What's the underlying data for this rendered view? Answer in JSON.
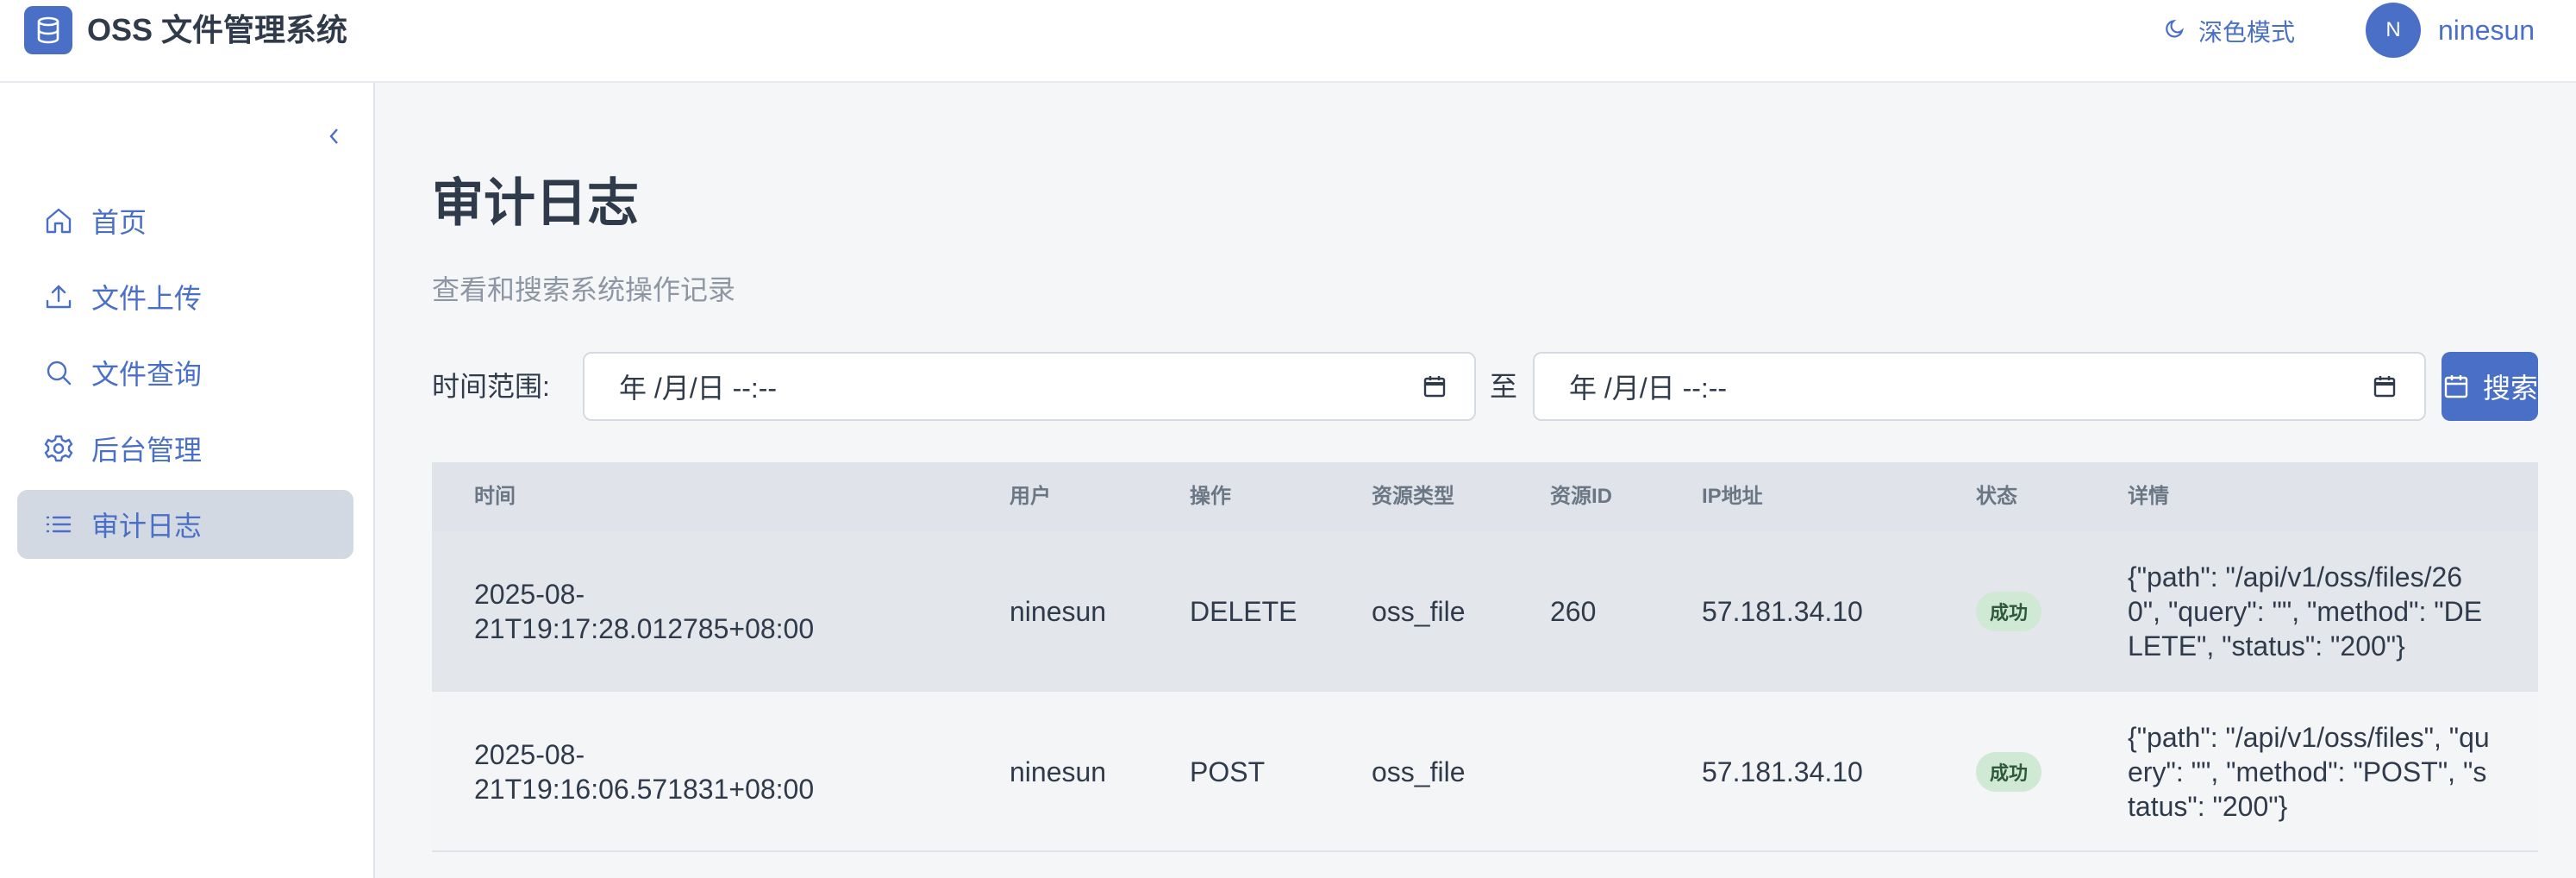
{
  "header": {
    "app_title": "OSS 文件管理系统",
    "dark_mode_label": "深色模式",
    "avatar_initial": "N",
    "username": "ninesun"
  },
  "sidebar": {
    "items": [
      {
        "label": "首页",
        "icon": "home-icon",
        "active": false
      },
      {
        "label": "文件上传",
        "icon": "upload-icon",
        "active": false
      },
      {
        "label": "文件查询",
        "icon": "search-icon",
        "active": false
      },
      {
        "label": "后台管理",
        "icon": "gear-icon",
        "active": false
      },
      {
        "label": "审计日志",
        "icon": "list-icon",
        "active": true
      }
    ]
  },
  "main": {
    "title": "审计日志",
    "subtitle": "查看和搜索系统操作记录",
    "filter": {
      "label": "时间范围:",
      "start_value": "年 /月/日 --:--",
      "separator": "至",
      "end_value": "年 /月/日 --:--",
      "search_label": "搜索"
    },
    "table": {
      "columns": [
        "时间",
        "用户",
        "操作",
        "资源类型",
        "资源ID",
        "IP地址",
        "状态",
        "详情"
      ],
      "rows": [
        {
          "time": "2025-08-21T19:17:28.012785+08:00",
          "user": "ninesun",
          "action": "DELETE",
          "resource_type": "oss_file",
          "resource_id": "260",
          "ip": "57.181.34.10",
          "status": "成功",
          "details": "{\"path\": \"/api/v1/oss/files/260\", \"query\": \"\", \"method\": \"DELETE\", \"status\": \"200\"}"
        },
        {
          "time": "2025-08-21T19:16:06.571831+08:00",
          "user": "ninesun",
          "action": "POST",
          "resource_type": "oss_file",
          "resource_id": "",
          "ip": "57.181.34.10",
          "status": "成功",
          "details": "{\"path\": \"/api/v1/oss/files\", \"query\": \"\", \"method\": \"POST\", \"status\": \"200\"}"
        }
      ]
    }
  },
  "colors": {
    "accent": "#4a6fc6",
    "success_badge_bg": "#cfe9d4",
    "active_nav_bg": "#d3d9e2"
  }
}
